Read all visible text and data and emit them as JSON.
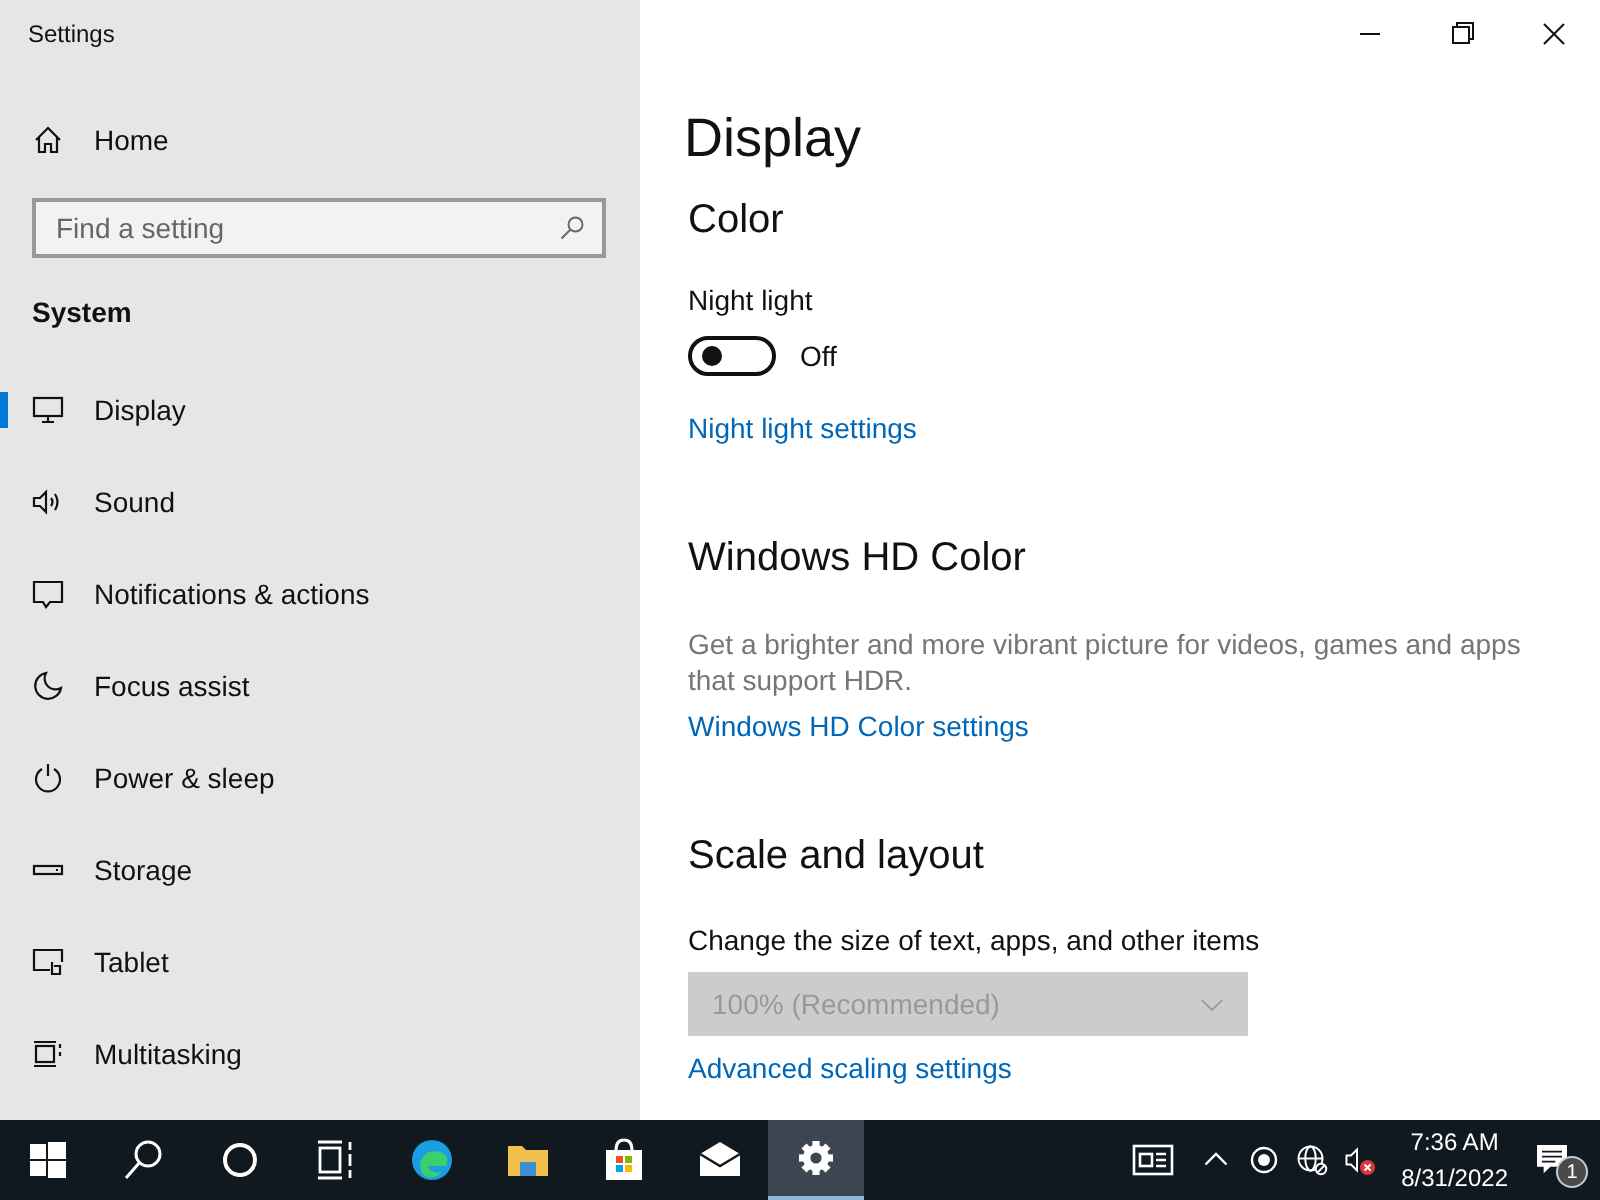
{
  "window": {
    "title": "Settings"
  },
  "sidebar": {
    "home": {
      "label": "Home"
    },
    "search": {
      "placeholder": "Find a setting"
    },
    "section": "System",
    "items": [
      {
        "label": "Display",
        "kind": "display",
        "selected": true
      },
      {
        "label": "Sound",
        "kind": "sound",
        "selected": false
      },
      {
        "label": "Notifications & actions",
        "kind": "notifications",
        "selected": false
      },
      {
        "label": "Focus assist",
        "kind": "focus",
        "selected": false
      },
      {
        "label": "Power & sleep",
        "kind": "power",
        "selected": false
      },
      {
        "label": "Storage",
        "kind": "storage",
        "selected": false
      },
      {
        "label": "Tablet",
        "kind": "tablet",
        "selected": false
      },
      {
        "label": "Multitasking",
        "kind": "multitasking",
        "selected": false
      }
    ]
  },
  "main": {
    "title": "Display",
    "color": {
      "heading": "Color",
      "night_light": {
        "label": "Night light",
        "on": false,
        "state_text": "Off"
      },
      "link": "Night light settings"
    },
    "hd_color": {
      "heading": "Windows HD Color",
      "description": "Get a brighter and more vibrant picture for videos, games and apps that support HDR.",
      "link": "Windows HD Color settings"
    },
    "scale": {
      "heading": "Scale and layout",
      "label": "Change the size of text, apps, and other items",
      "dropdown": {
        "value": "100% (Recommended)",
        "disabled": true
      },
      "link": "Advanced scaling settings"
    }
  },
  "taskbar": {
    "apps": [
      {
        "kind": "start",
        "active": false
      },
      {
        "kind": "search",
        "active": false
      },
      {
        "kind": "cortana",
        "active": false
      },
      {
        "kind": "taskview",
        "active": false
      },
      {
        "kind": "edge",
        "active": false
      },
      {
        "kind": "explorer",
        "active": false
      },
      {
        "kind": "store",
        "active": false
      },
      {
        "kind": "mail",
        "active": false
      },
      {
        "kind": "settings",
        "active": true
      }
    ],
    "time": "7:36 AM",
    "date": "8/31/2022",
    "notification_count": "1"
  }
}
